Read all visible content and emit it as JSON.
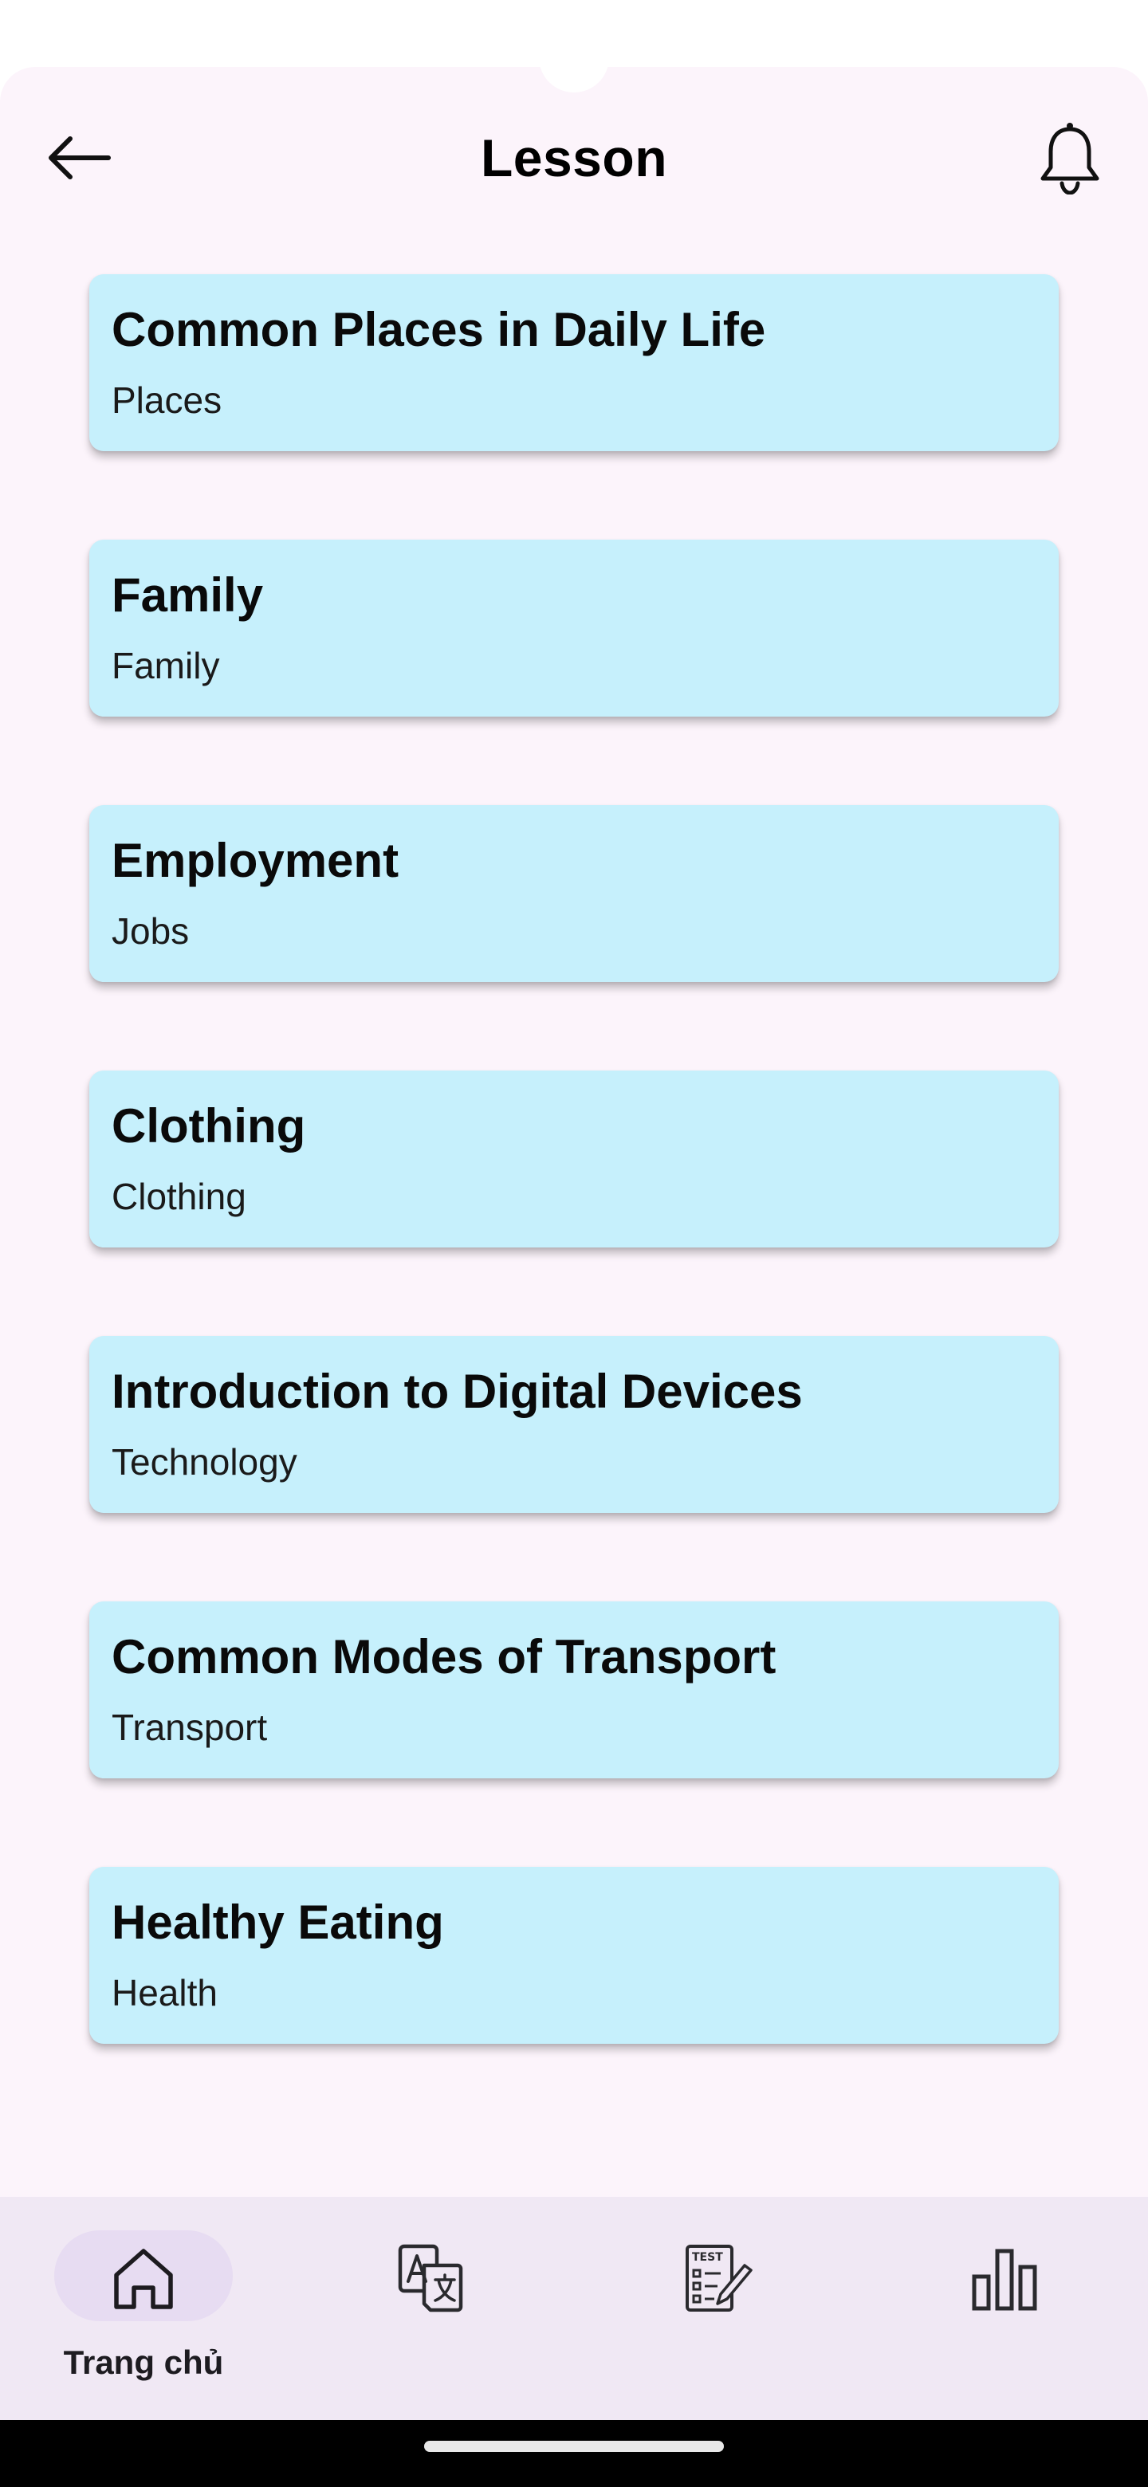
{
  "header": {
    "title": "Lesson",
    "back_icon": "arrow-left-icon",
    "notification_icon": "bell-icon"
  },
  "lessons": [
    {
      "title": "Common Places in Daily Life",
      "subtitle": "Places"
    },
    {
      "title": "Family",
      "subtitle": "Family"
    },
    {
      "title": "Employment",
      "subtitle": "Jobs"
    },
    {
      "title": "Clothing",
      "subtitle": "Clothing"
    },
    {
      "title": "Introduction to Digital Devices",
      "subtitle": "Technology"
    },
    {
      "title": "Common Modes of Transport",
      "subtitle": "Transport"
    },
    {
      "title": "Healthy Eating",
      "subtitle": "Health"
    }
  ],
  "bottom_nav": {
    "items": [
      {
        "label": "Trang chủ",
        "icon": "home-icon",
        "selected": true
      },
      {
        "label": "",
        "icon": "translate-icon",
        "selected": false
      },
      {
        "label": "",
        "icon": "test-icon",
        "selected": false
      },
      {
        "label": "",
        "icon": "bar-chart-icon",
        "selected": false
      }
    ]
  },
  "colors": {
    "background": "#fcf4fb",
    "card": "#c6f0fc",
    "nav_background": "#f0e8f4",
    "nav_selected_pill": "#e7dcf2"
  }
}
